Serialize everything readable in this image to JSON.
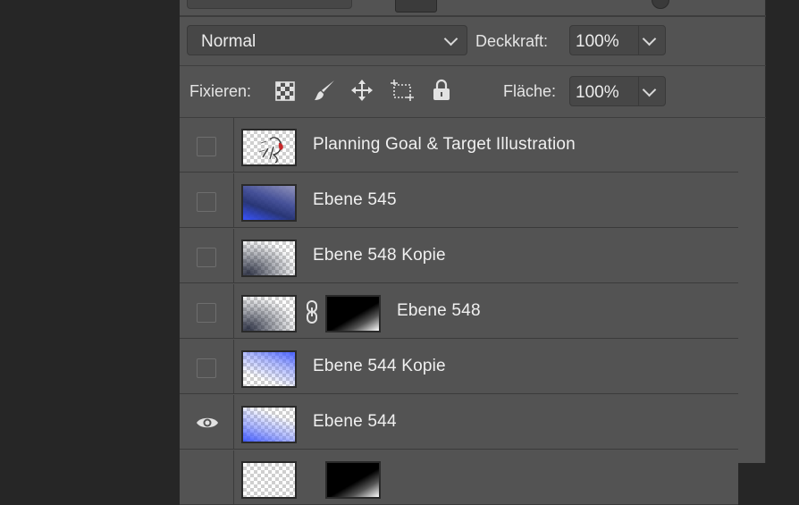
{
  "blend": {
    "mode": "Normal"
  },
  "opacity": {
    "label": "Deckkraft:",
    "value": "100%"
  },
  "lock": {
    "label": "Fixieren:",
    "icons": [
      "lock-transparent-pixels-icon",
      "lock-image-pixels-icon",
      "lock-position-icon",
      "lock-artboard-icon",
      "lock-all-icon"
    ]
  },
  "fill": {
    "label": "Fläche:",
    "value": "100%"
  },
  "layers": [
    {
      "name": "Planning Goal & Target Illustration",
      "visible": false,
      "thumb": "illustration"
    },
    {
      "name": "Ebene 545",
      "visible": false,
      "thumb": "blue-dark"
    },
    {
      "name": "Ebene 548 Kopie",
      "visible": false,
      "thumb": "dark-corner"
    },
    {
      "name": "Ebene 548",
      "visible": false,
      "thumb": "dark-corner",
      "has_mask": true
    },
    {
      "name": "Ebene 544 Kopie",
      "visible": false,
      "thumb": "blue-light"
    },
    {
      "name": "Ebene 544",
      "visible": true,
      "thumb": "blue-light"
    }
  ],
  "colors": {
    "panel": "#535353",
    "background": "#262626",
    "accent_blue": "#2f4bff"
  }
}
